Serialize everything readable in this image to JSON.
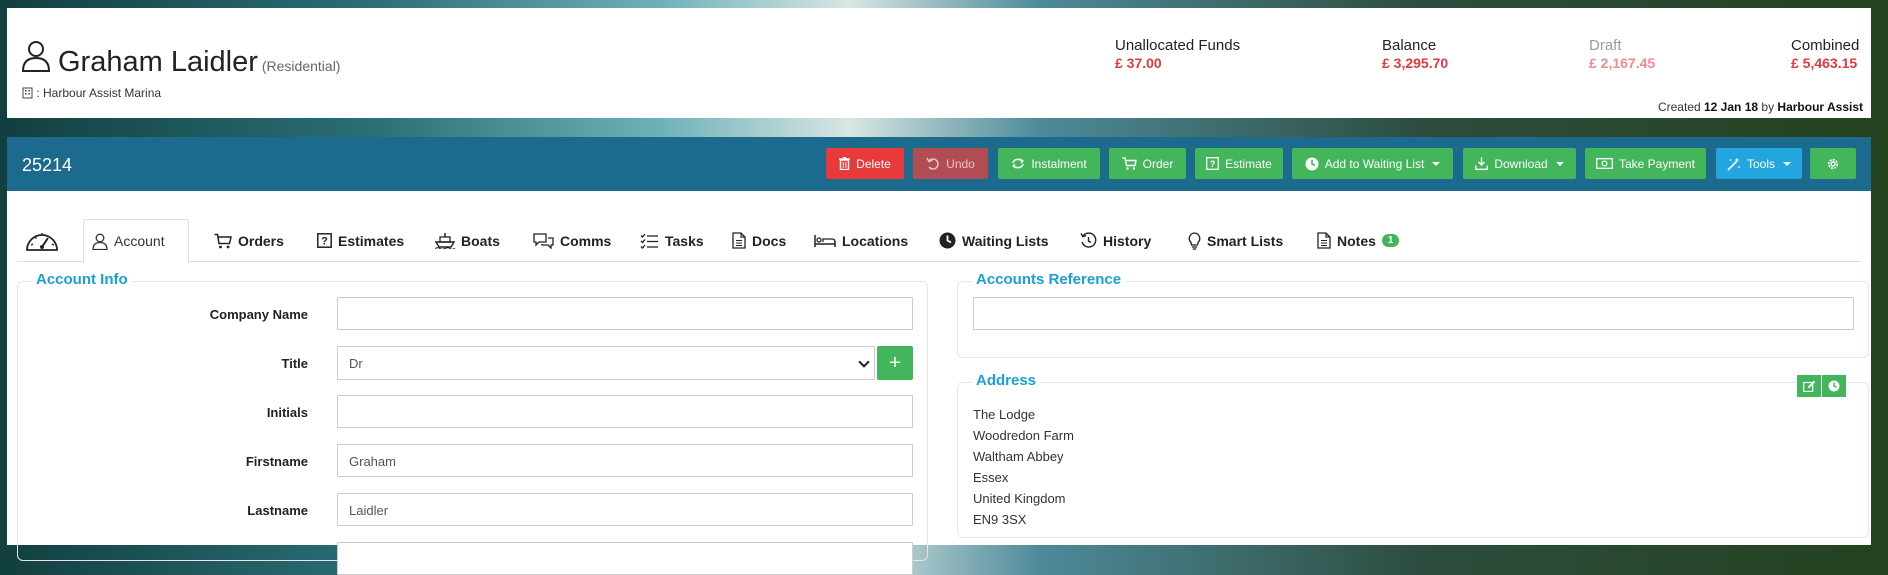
{
  "customer": {
    "name": "Graham Laidler",
    "type": "(Residential)",
    "marina": ": Harbour Assist Marina"
  },
  "financials": [
    {
      "label": "Unallocated Funds",
      "value": "£ 37.00"
    },
    {
      "label": "Balance",
      "value": "£ 3,295.70"
    },
    {
      "label": "Draft",
      "value": "£ 2,167.45"
    },
    {
      "label": "Combined",
      "value": "£ 5,463.15"
    }
  ],
  "created": {
    "prefix": "Created",
    "date": "12 Jan 18",
    "by": "by",
    "author": "Harbour Assist"
  },
  "toolbar": {
    "account_number": "25214",
    "delete": "Delete",
    "undo": "Undo",
    "instalment": "Instalment",
    "order": "Order",
    "estimate": "Estimate",
    "waiting_list": "Add to Waiting List",
    "download": "Download",
    "take_payment": "Take Payment",
    "tools": "Tools"
  },
  "tabs": {
    "account": "Account",
    "orders": "Orders",
    "estimates": "Estimates",
    "boats": "Boats",
    "comms": "Comms",
    "tasks": "Tasks",
    "docs": "Docs",
    "locations": "Locations",
    "waiting_lists": "Waiting Lists",
    "history": "History",
    "smart_lists": "Smart Lists",
    "notes": "Notes",
    "notes_count": "1"
  },
  "account_info": {
    "legend": "Account Info",
    "company_label": "Company Name",
    "company_value": "",
    "title_label": "Title",
    "title_value": "Dr",
    "initials_label": "Initials",
    "initials_value": "",
    "firstname_label": "Firstname",
    "firstname_value": "Graham",
    "lastname_label": "Lastname",
    "lastname_value": "Laidler"
  },
  "accounts_reference": {
    "legend": "Accounts Reference",
    "value": ""
  },
  "address": {
    "legend": "Address",
    "lines": [
      "The Lodge",
      "Woodredon Farm",
      "Waltham Abbey",
      "Essex",
      "United Kingdom",
      "EN9 3SX"
    ]
  },
  "colors": {
    "accent": "#1a9fd6",
    "green": "#43b55a",
    "red": "#e8393b",
    "toolbar": "#1d6a8f"
  }
}
